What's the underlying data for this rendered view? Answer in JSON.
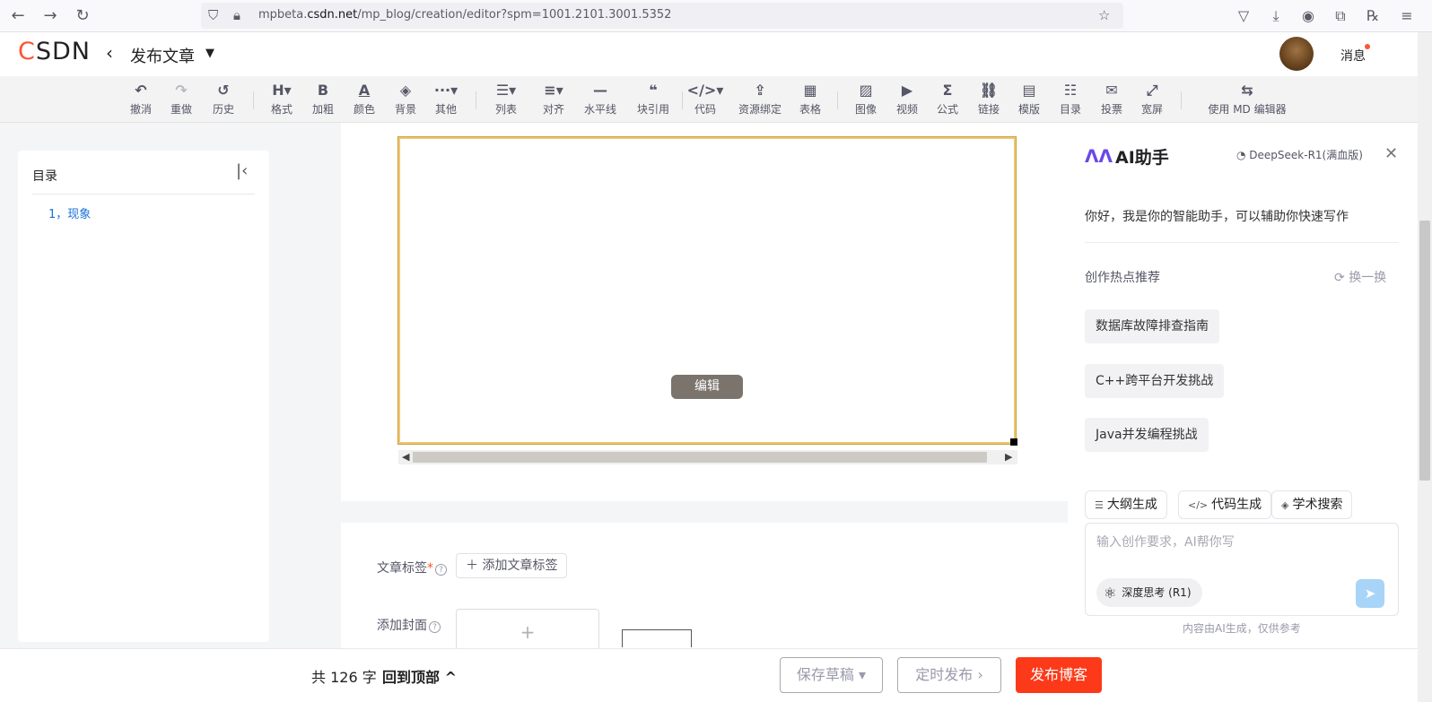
{
  "browser": {
    "url_prefix": "mpbeta.",
    "url_domain": "csdn.net",
    "url_path": "/mp_blog/creation/editor?spm=1001.2101.3001.5352"
  },
  "header": {
    "logo": "CSDN",
    "title": "发布文章",
    "messages": "消息"
  },
  "toolbar": {
    "items": [
      {
        "icon": "undo-icon",
        "glyph": "↶",
        "label": "撤消"
      },
      {
        "icon": "redo-icon",
        "glyph": "↷",
        "label": "重做"
      },
      {
        "icon": "history-icon",
        "glyph": "↺",
        "label": "历史"
      },
      {
        "icon": "heading-icon",
        "glyph": "H▾",
        "label": "格式"
      },
      {
        "icon": "bold-icon",
        "glyph": "B",
        "label": "加粗"
      },
      {
        "icon": "font-color-icon",
        "glyph": "A",
        "label": "颜色"
      },
      {
        "icon": "background-color-icon",
        "glyph": "◈",
        "label": "背景"
      },
      {
        "icon": "more-icon",
        "glyph": "···▾",
        "label": "其他"
      },
      {
        "icon": "list-icon",
        "glyph": "☰▾",
        "label": "列表"
      },
      {
        "icon": "align-icon",
        "glyph": "≡▾",
        "label": "对齐"
      },
      {
        "icon": "horizontal-rule-icon",
        "glyph": "—",
        "label": "水平线"
      },
      {
        "icon": "blockquote-icon",
        "glyph": "❝",
        "label": "块引用"
      },
      {
        "icon": "code-icon",
        "glyph": "</>▾",
        "label": "代码"
      },
      {
        "icon": "resource-bind-icon",
        "glyph": "⇪",
        "label": "资源绑定"
      },
      {
        "icon": "table-icon",
        "glyph": "▦",
        "label": "表格"
      },
      {
        "icon": "image-icon",
        "glyph": "▨",
        "label": "图像"
      },
      {
        "icon": "video-icon",
        "glyph": "▶",
        "label": "视频"
      },
      {
        "icon": "formula-icon",
        "glyph": "Σ",
        "label": "公式"
      },
      {
        "icon": "link-icon",
        "glyph": "⛓",
        "label": "链接"
      },
      {
        "icon": "template-icon",
        "glyph": "▤",
        "label": "模版"
      },
      {
        "icon": "toc-icon",
        "glyph": "☷",
        "label": "目录"
      },
      {
        "icon": "vote-icon",
        "glyph": "✉",
        "label": "投票"
      },
      {
        "icon": "widescreen-icon",
        "glyph": "⤢",
        "label": "宽屏"
      },
      {
        "icon": "md-editor-icon",
        "glyph": "⇆",
        "label": "使用 MD 编辑器"
      }
    ]
  },
  "toc": {
    "title": "目录",
    "items": [
      "1，现象"
    ]
  },
  "editor": {
    "edit_button": "编辑"
  },
  "meta": {
    "tags_label": "文章标签",
    "required_mark": "*",
    "add_tag": "添加文章标签",
    "cover_label": "添加封面",
    "cover_plus": "+"
  },
  "ai": {
    "title": "AI助手",
    "model": "DeepSeek-R1(满血版)",
    "greeting": "你好，我是你的智能助手，可以辅助你快速写作",
    "hot_title": "创作热点推荐",
    "refresh": "换一换",
    "suggestions": [
      "数据库故障排查指南",
      "C++跨平台开发挑战",
      "Java并发编程挑战"
    ],
    "actions": [
      "大纲生成",
      "代码生成",
      "学术搜索"
    ],
    "input_placeholder": "输入创作要求，AI帮你写",
    "deep_think": "深度思考 (R1)",
    "disclaimer": "内容由AI生成，仅供参考"
  },
  "footer": {
    "word_count": "共 126 字",
    "back_to_top": "回到顶部",
    "save_draft": "保存草稿",
    "schedule": "定时发布",
    "publish": "发布博客"
  },
  "colors": {
    "brand": "#fc5531",
    "publish": "#fc3a1a",
    "link": "#1a70d7"
  }
}
